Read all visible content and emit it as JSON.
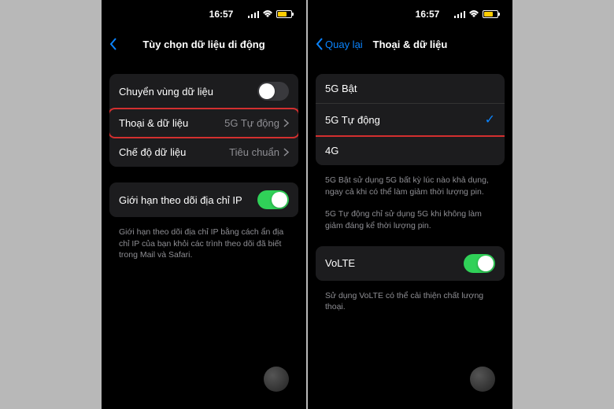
{
  "status": {
    "time": "16:57"
  },
  "phone_left": {
    "nav_title": "Tùy chọn dữ liệu di động",
    "rows": {
      "roaming": {
        "label": "Chuyển vùng dữ liệu"
      },
      "voice_data": {
        "label": "Thoại & dữ liệu",
        "value": "5G Tự động"
      },
      "data_mode": {
        "label": "Chế độ dữ liệu",
        "value": "Tiêu chuẩn"
      },
      "ip_limit": {
        "label": "Giới hạn theo dõi địa chỉ IP"
      }
    },
    "ip_footer": "Giới hạn theo dõi địa chỉ IP bằng cách ẩn địa chỉ IP của bạn khỏi các trình theo dõi đã biết trong Mail và Safari."
  },
  "phone_right": {
    "nav_back": "Quay lại",
    "nav_title": "Thoại & dữ liệu",
    "options": {
      "on5g": {
        "label": "5G Bật"
      },
      "auto5g": {
        "label": "5G Tự động"
      },
      "g4": {
        "label": "4G"
      }
    },
    "footer1": "5G Bật sử dụng 5G bất kỳ lúc nào khả dụng, ngay cả khi có thể làm giảm thời lượng pin.",
    "footer2": "5G Tự động chỉ sử dụng 5G khi không làm giảm đáng kể thời lượng pin.",
    "volte": {
      "label": "VoLTE"
    },
    "volte_footer": "Sử dụng VoLTE có thể cải thiện chất lượng thoại."
  }
}
